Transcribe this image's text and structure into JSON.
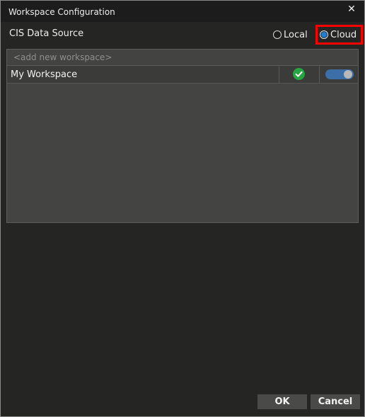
{
  "window": {
    "title": "Workspace Configuration",
    "close_glyph": "✕"
  },
  "data_source": {
    "label": "CIS Data Source",
    "options": [
      {
        "label": "Local",
        "selected": false
      },
      {
        "label": "Cloud",
        "selected": true
      }
    ]
  },
  "workspaces": {
    "new_placeholder": "<add new workspace>",
    "rows": [
      {
        "name": "My Workspace",
        "status": "check-circle-icon",
        "enabled": true
      }
    ]
  },
  "buttons": {
    "ok": "OK",
    "cancel": "Cancel"
  },
  "colors": {
    "highlight": "#ff0000",
    "accent": "#1f7fd3",
    "status_ok": "#27a542",
    "toggle_on": "#3c6fa8"
  }
}
